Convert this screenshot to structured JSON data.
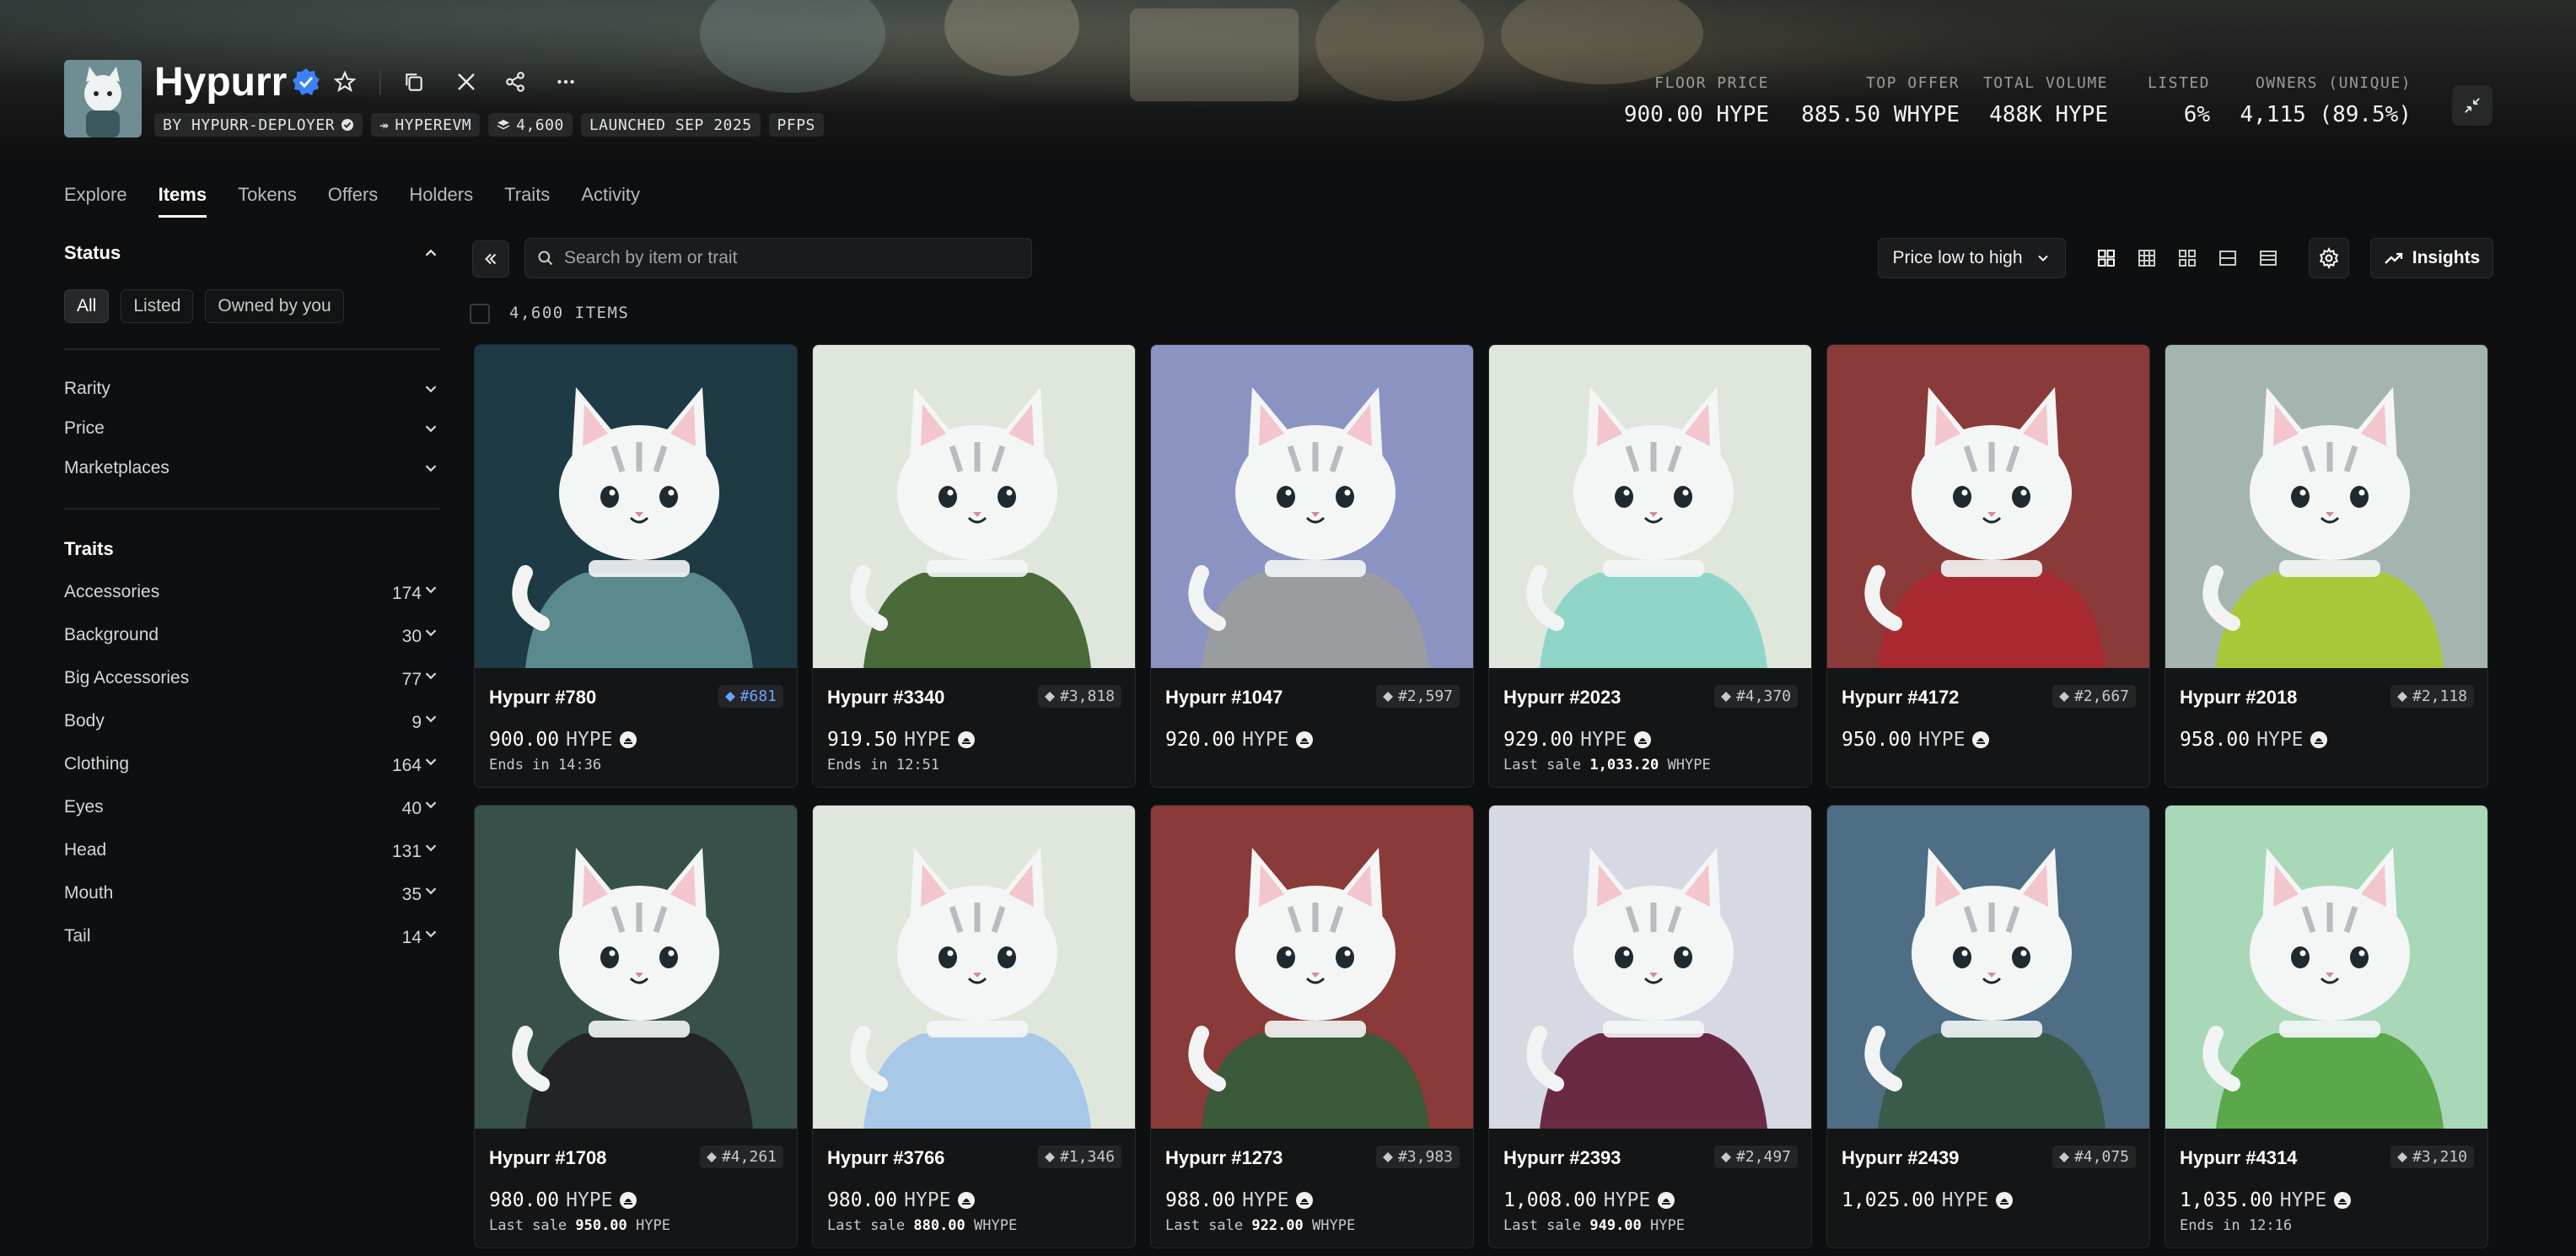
{
  "collection": {
    "name": "Hypurr",
    "chips": [
      "BY HYPURR-DEPLOYER",
      "HYPEREVM",
      "4,600",
      "LAUNCHED SEP 2025",
      "PFPS"
    ]
  },
  "stats": [
    {
      "label": "FLOOR PRICE",
      "value": "900.00 HYPE"
    },
    {
      "label": "TOP OFFER",
      "value": "885.50 WHYPE"
    },
    {
      "label": "TOTAL VOLUME",
      "value": "488K HYPE"
    },
    {
      "label": "LISTED",
      "value": "6%"
    },
    {
      "label": "OWNERS (UNIQUE)",
      "value": "4,115 (89.5%)"
    }
  ],
  "tabs": [
    "Explore",
    "Items",
    "Tokens",
    "Offers",
    "Holders",
    "Traits",
    "Activity"
  ],
  "active_tab": "Items",
  "sidebar": {
    "status_title": "Status",
    "status_filters": [
      "All",
      "Listed",
      "Owned by you"
    ],
    "sections": [
      "Rarity",
      "Price",
      "Marketplaces"
    ],
    "traits_title": "Traits",
    "traits": [
      {
        "name": "Accessories",
        "count": "174"
      },
      {
        "name": "Background",
        "count": "30"
      },
      {
        "name": "Big Accessories",
        "count": "77"
      },
      {
        "name": "Body",
        "count": "9"
      },
      {
        "name": "Clothing",
        "count": "164"
      },
      {
        "name": "Eyes",
        "count": "40"
      },
      {
        "name": "Head",
        "count": "131"
      },
      {
        "name": "Mouth",
        "count": "35"
      },
      {
        "name": "Tail",
        "count": "14"
      }
    ]
  },
  "toolbar": {
    "search_placeholder": "Search by item or trait",
    "sort_label": "Price low to high",
    "insights_label": "Insights",
    "items_count": "4,600 ITEMS"
  },
  "items": [
    {
      "name": "Hypurr #780",
      "rank": "#681",
      "price": "900.00",
      "unit": "HYPE",
      "sub_prefix": "Ends in 14:36",
      "sub_value": "",
      "sub_unit": "",
      "bg": "#1e3a44",
      "accent": "#5a8a8c",
      "highlight": true
    },
    {
      "name": "Hypurr #3340",
      "rank": "#3,818",
      "price": "919.50",
      "unit": "HYPE",
      "sub_prefix": "Ends in 12:51",
      "sub_value": "",
      "sub_unit": "",
      "bg": "#dfe7dc",
      "accent": "#4a6a3a",
      "highlight": false
    },
    {
      "name": "Hypurr #1047",
      "rank": "#2,597",
      "price": "920.00",
      "unit": "HYPE",
      "sub_prefix": "",
      "sub_value": "",
      "sub_unit": "",
      "bg": "#8a93c2",
      "accent": "#9a9ca0",
      "highlight": false
    },
    {
      "name": "Hypurr #2023",
      "rank": "#4,370",
      "price": "929.00",
      "unit": "HYPE",
      "sub_prefix": "Last sale ",
      "sub_value": "1,033.20",
      "sub_unit": "WHYPE",
      "bg": "#dfe7dc",
      "accent": "#8fd6c8",
      "highlight": false
    },
    {
      "name": "Hypurr #4172",
      "rank": "#2,667",
      "price": "950.00",
      "unit": "HYPE",
      "sub_prefix": "",
      "sub_value": "",
      "sub_unit": "",
      "bg": "#8a3a38",
      "accent": "#a82a30",
      "highlight": false
    },
    {
      "name": "Hypurr #2018",
      "rank": "#2,118",
      "price": "958.00",
      "unit": "HYPE",
      "sub_prefix": "",
      "sub_value": "",
      "sub_unit": "",
      "bg": "#a3b5ae",
      "accent": "#a8c83a",
      "highlight": false
    },
    {
      "name": "Hypurr #1708",
      "rank": "#4,261",
      "price": "980.00",
      "unit": "HYPE",
      "sub_prefix": "Last sale ",
      "sub_value": "950.00",
      "sub_unit": "HYPE",
      "bg": "#38504a",
      "accent": "#222428",
      "highlight": false
    },
    {
      "name": "Hypurr #3766",
      "rank": "#1,346",
      "price": "980.00",
      "unit": "HYPE",
      "sub_prefix": "Last sale ",
      "sub_value": "880.00",
      "sub_unit": "WHYPE",
      "bg": "#dfe7dc",
      "accent": "#a8c8e8",
      "highlight": false
    },
    {
      "name": "Hypurr #1273",
      "rank": "#3,983",
      "price": "988.00",
      "unit": "HYPE",
      "sub_prefix": "Last sale ",
      "sub_value": "922.00",
      "sub_unit": "WHYPE",
      "bg": "#8a3a38",
      "accent": "#3a5a3a",
      "highlight": false
    },
    {
      "name": "Hypurr #2393",
      "rank": "#2,497",
      "price": "1,008.00",
      "unit": "HYPE",
      "sub_prefix": "Last sale ",
      "sub_value": "949.00",
      "sub_unit": "HYPE",
      "bg": "#d6d8e4",
      "accent": "#6a2a44",
      "highlight": false
    },
    {
      "name": "Hypurr #2439",
      "rank": "#4,075",
      "price": "1,025.00",
      "unit": "HYPE",
      "sub_prefix": "",
      "sub_value": "",
      "sub_unit": "",
      "bg": "#4d6e84",
      "accent": "#3a5a4a",
      "highlight": false
    },
    {
      "name": "Hypurr #4314",
      "rank": "#3,210",
      "price": "1,035.00",
      "unit": "HYPE",
      "sub_prefix": "Ends in 12:16",
      "sub_value": "",
      "sub_unit": "",
      "bg": "#a8d8b8",
      "accent": "#5aa84a",
      "highlight": false
    }
  ]
}
